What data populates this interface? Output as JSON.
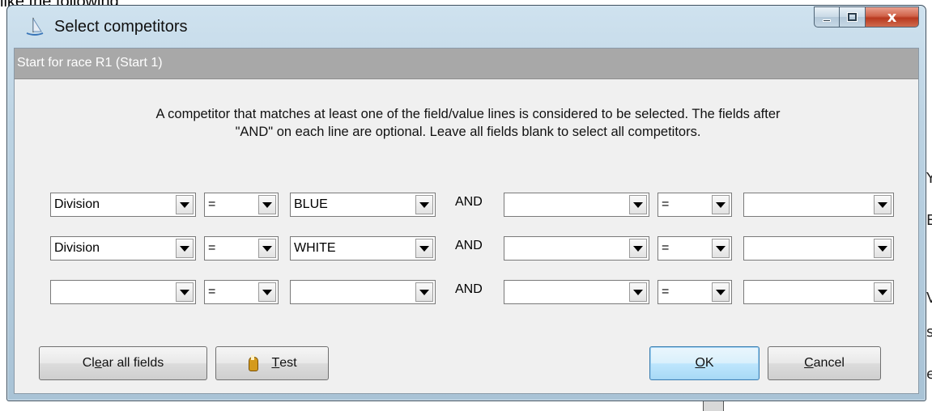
{
  "page_caption": "like the following",
  "window": {
    "title": "Select competitors",
    "minimize_label": "",
    "maximize_label": "",
    "close_label": "x"
  },
  "header": {
    "text": "Start for race R1 (Start 1)"
  },
  "instructions": {
    "line1": "A competitor that matches at least one of the field/value lines is considered to be selected.  The fields after",
    "line2": "\"AND\" on each line are optional.  Leave all fields blank to select all competitors."
  },
  "rows": [
    {
      "field1": "Division",
      "op1": "=",
      "value1": "BLUE",
      "and_label": "AND",
      "field2": "",
      "op2": "=",
      "value2": ""
    },
    {
      "field1": "Division",
      "op1": "=",
      "value1": "WHITE",
      "and_label": "AND",
      "field2": "",
      "op2": "=",
      "value2": ""
    },
    {
      "field1": "",
      "op1": "=",
      "value1": "",
      "and_label": "AND",
      "field2": "",
      "op2": "=",
      "value2": ""
    }
  ],
  "buttons": {
    "clear_pre": "Cl",
    "clear_accel": "e",
    "clear_post": "ar all fields",
    "test_accel": "T",
    "test_post": "est",
    "ok_accel": "O",
    "ok_post": "K",
    "cancel_accel": "C",
    "cancel_post": "ancel"
  },
  "background": {
    "right_letters": [
      "Y",
      "E",
      "V",
      "s",
      "e"
    ]
  }
}
